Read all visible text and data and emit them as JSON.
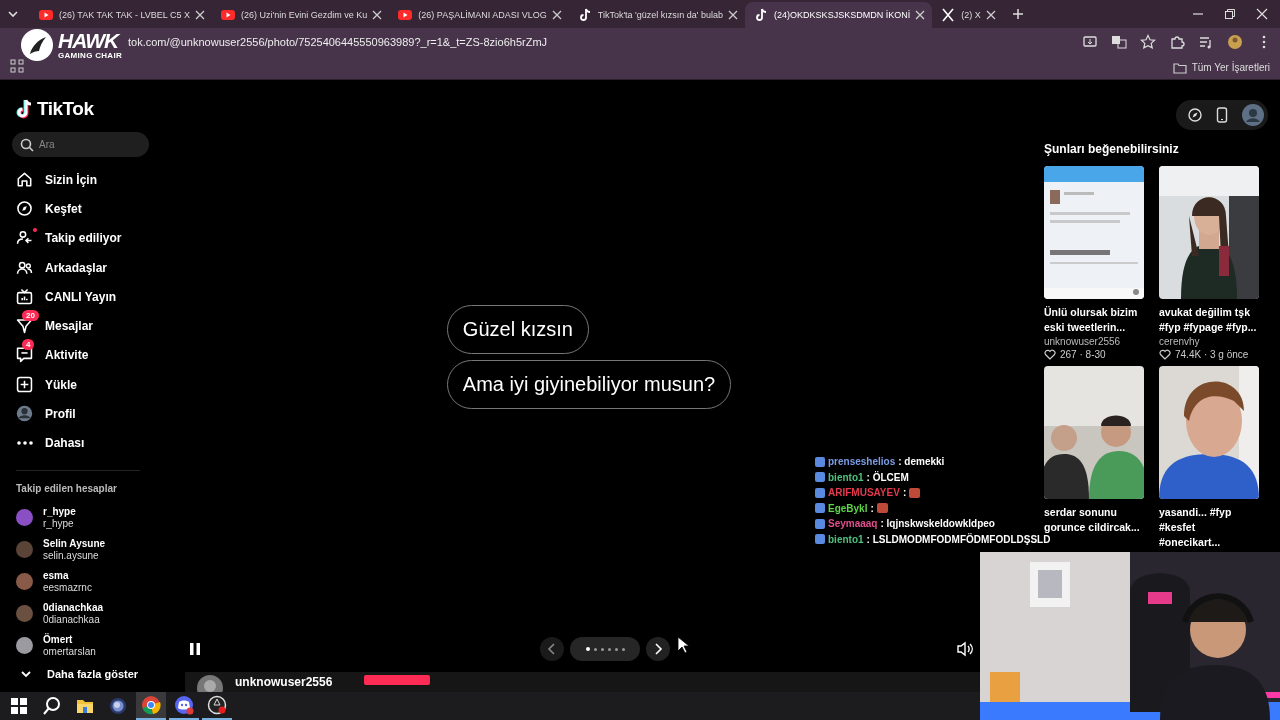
{
  "browser": {
    "tabs": [
      {
        "kind": "youtube",
        "title": "(26) TAK TAK TAK - LVBEL C5 X",
        "selected": false
      },
      {
        "kind": "youtube",
        "title": "(26) Uzi'nin Evini Gezdim ve Ku",
        "selected": false
      },
      {
        "kind": "youtube",
        "title": "(26) PAŞALİMANI ADASI VLOG",
        "selected": false
      },
      {
        "kind": "tiktok",
        "title": "TikTok'ta 'güzel kızsın da' bulab",
        "selected": false
      },
      {
        "kind": "tiktok",
        "title": "(24)OKDKSKSJSKSDMDN İKONİ",
        "selected": true
      },
      {
        "kind": "x",
        "title": "(2) X",
        "selected": false
      }
    ],
    "url": "tok.com/@unknowuser2556/photo/7525406445550963989?_r=1&_t=ZS-8zio6h5rZmJ",
    "bookmarks_folder": "Tüm Yer İşaretleri"
  },
  "overlay_logo": {
    "name": "HAWK",
    "tagline": "GAMING CHAIR"
  },
  "sidebar": {
    "logo": "TikTok",
    "search": {
      "placeholder": "Ara"
    },
    "items": [
      {
        "kind": "home",
        "label": "Sizin İçin"
      },
      {
        "kind": "compass",
        "label": "Keşfet"
      },
      {
        "kind": "following",
        "label": "Takip ediliyor",
        "dot": true
      },
      {
        "kind": "friends",
        "label": "Arkadaşlar"
      },
      {
        "kind": "live",
        "label": "CANLI Yayın"
      },
      {
        "kind": "messages",
        "label": "Mesajlar",
        "badge": "20"
      },
      {
        "kind": "activity",
        "label": "Aktivite",
        "badge": "4"
      },
      {
        "kind": "upload",
        "label": "Yükle"
      },
      {
        "kind": "profile",
        "label": "Profil"
      },
      {
        "kind": "more",
        "label": "Dahası"
      }
    ],
    "following_title": "Takip edilen hesaplar",
    "following": [
      {
        "name": "r_hype",
        "handle": "r_hype",
        "color": "#8a4fc4"
      },
      {
        "name": "Selin Aysune",
        "handle": "selin.aysune",
        "color": "#5a4438"
      },
      {
        "name": "esma",
        "handle": "eesmazrnc",
        "color": "#8a5a48"
      },
      {
        "name": "0dianachkaa",
        "handle": "0dianachkaa",
        "color": "#6a5040"
      },
      {
        "name": "Ömert",
        "handle": "omertarslan",
        "color": "#9a9aa0"
      }
    ],
    "show_more": "Daha fazla göster"
  },
  "post": {
    "bubbles": [
      "Güzel kızsın",
      "Ama iyi giyinebiliyor musun?"
    ],
    "pager": [
      {
        "selected": true
      },
      {
        "selected": false
      },
      {
        "selected": false
      },
      {
        "selected": false
      },
      {
        "selected": false
      },
      {
        "selected": false
      }
    ],
    "author": "unknowuser2556"
  },
  "suggestions": {
    "title": "Şunları beğenebilirsiniz",
    "cards": [
      {
        "title": "Ünlü olursak bizim eski tweetlerin...",
        "author": "unknowuser2556",
        "stats": "267 · 8-30"
      },
      {
        "title": "avukat değilim tşk #fyp #fypage #fyp...",
        "author": "cerenvhy",
        "stats": "74.4K · 3 g önce"
      },
      {
        "title": "serdar sonunu gorunce cildircak..."
      },
      {
        "title": "yasandi... #fyp #kesfet #onecikart..."
      }
    ]
  },
  "chat": [
    {
      "user": "prenseshelios",
      "color": "#7c9de6",
      "message": ": demekki"
    },
    {
      "user": "biento1",
      "color": "#4fc07e",
      "message": ": ÖLCEM"
    },
    {
      "user": "ARIFMUSAYEV",
      "color": "#e23a4e",
      "message": ":",
      "emote": true
    },
    {
      "user": "EgeBykl",
      "color": "#5ed44a",
      "message": ":",
      "emote": true
    },
    {
      "user": "Seymaaaq",
      "color": "#e0508c",
      "message": ": lqjnskwskeldowkldpeo"
    },
    {
      "user": "biento1",
      "color": "#4fc07e",
      "message": ": LSLDMODMFODMFÖDMFODLDŞSLD"
    }
  ],
  "taskbar": [
    {
      "kind": "windows"
    },
    {
      "kind": "search"
    },
    {
      "kind": "folder"
    },
    {
      "kind": "orb"
    },
    {
      "kind": "chrome",
      "selected": true
    },
    {
      "kind": "discord",
      "selected": false
    },
    {
      "kind": "recorder",
      "selected": false
    }
  ]
}
